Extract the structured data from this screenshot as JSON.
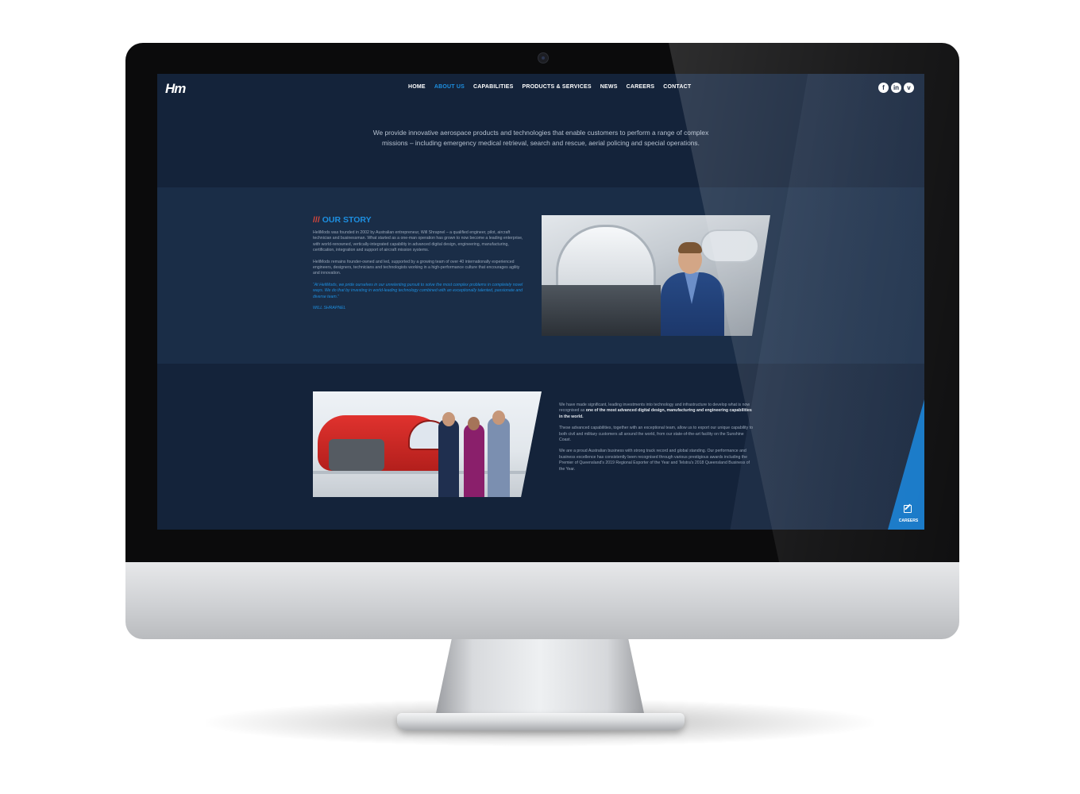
{
  "nav": {
    "logo": "Hm",
    "items": [
      {
        "label": "HOME",
        "active": false
      },
      {
        "label": "ABOUT US",
        "active": true
      },
      {
        "label": "CAPABILITIES",
        "active": false
      },
      {
        "label": "PRODUCTS & SERVICES",
        "active": false
      },
      {
        "label": "NEWS",
        "active": false
      },
      {
        "label": "CAREERS",
        "active": false
      },
      {
        "label": "CONTACT",
        "active": false
      }
    ],
    "social": [
      {
        "icon": "facebook-icon",
        "glyph": "f"
      },
      {
        "icon": "linkedin-icon",
        "glyph": "in"
      },
      {
        "icon": "vimeo-icon",
        "glyph": "v"
      }
    ]
  },
  "intro": "We provide innovative aerospace products and technologies that enable customers to perform a range of complex missions – including emergency medical retrieval, search and rescue, aerial policing and special operations.",
  "story": {
    "prefix": "///",
    "heading": "OUR STORY",
    "paragraphs": [
      "HeliMods was founded in 2002 by Australian entrepreneur, Will Shrapnel – a qualified engineer, pilot, aircraft technician and businessman. What started as a one-man operation has grown to now become a leading enterprise, with world-renowned, vertically-integrated capability in advanced digital design, engineering, manufacturing, certification, integration and support of aircraft mission systems.",
      "HeliMods remains founder-owned and led, supported by a growing team of over 40 internationally experienced engineers, designers, technicians and technologists working in a high-performance culture that encourages agility and innovation."
    ],
    "quote": "“At HeliMods, we pride ourselves in our unrelenting pursuit to solve the most complex problems in completely novel ways. We do that by investing in world-leading technology combined with an exceptionally talented, passionate and diverse team.”",
    "signature": "WILL SHRAPNEL"
  },
  "capabilities_text": {
    "p1_before": "We have made significant, leading investments into technology and infrastructure to develop what is now recognised as ",
    "p1_bold": "one of the most advanced digital design, manufacturing and engineering capabilities in the world.",
    "p2": "These advanced capabilities, together with an exceptional team, allow us to export our unique capability to both civil and military customers all around the world, from our state-of-the-art facility on the Sunshine Coast.",
    "p3": "We are a proud Australian business with strong track record and global standing. Our performance and business excellence has consistently been recognised through various prestigious awards including the Premier of Queensland's 2019 Regional Exporter of the Year and Telstra's 2018 Queensland Business of the Year."
  },
  "careers_tab": {
    "label": "CAREERS",
    "icon": "edit-icon"
  },
  "colors": {
    "accent": "#1d8fe1",
    "slashes": "#e0483b",
    "bg_dark": "#14233a",
    "bg_mid": "#1a2d47",
    "careers_bg": "#1477c7"
  }
}
